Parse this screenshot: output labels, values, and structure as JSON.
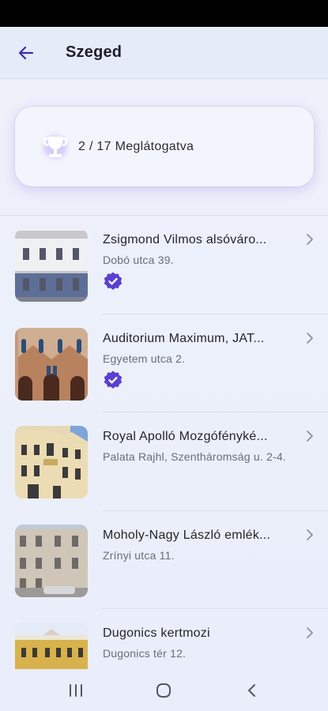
{
  "header": {
    "title": "Szeged",
    "back_icon": "arrow-left-icon"
  },
  "progress": {
    "text": "2 / 17 Meglátogatva",
    "visited": 2,
    "total": 17,
    "icon": "trophy-icon"
  },
  "places": [
    {
      "title": "Zsigmond Vilmos alsóváro...",
      "address": "Dobó utca 39.",
      "verified": true
    },
    {
      "title": "Auditorium Maximum, JAT...",
      "address": "Egyetem utca 2.",
      "verified": true
    },
    {
      "title": "Royal Apolló Mozgófényké...",
      "address": "Palata Rajhl, Szentháromság u. 2-4.",
      "verified": false
    },
    {
      "title": "Moholy-Nagy László emlék...",
      "address": "Zrínyi utca 11.",
      "verified": false
    },
    {
      "title": "Dugonics kertmozi",
      "address": "Dugonics tér 12.",
      "verified": false
    }
  ],
  "colors": {
    "accent": "#5b3fd1",
    "background": "#eef1fa",
    "app_bar": "#e6ebf8"
  },
  "system_nav": [
    "recents-icon",
    "home-icon",
    "back-icon"
  ]
}
